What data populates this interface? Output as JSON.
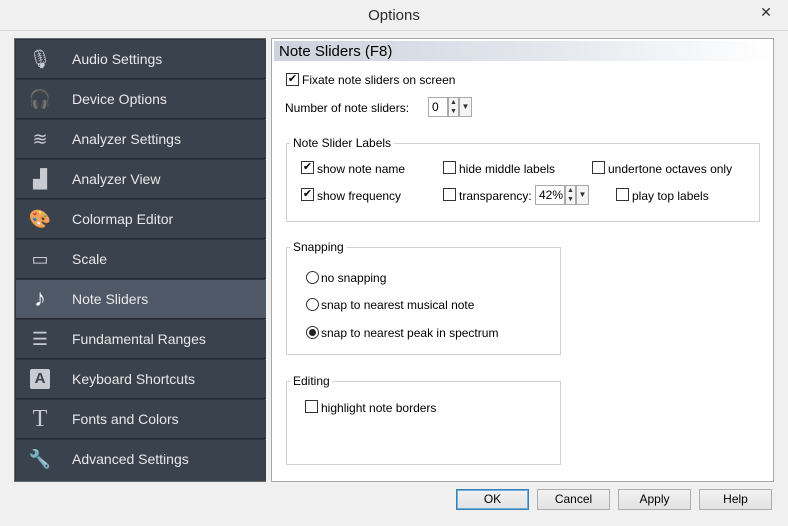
{
  "window": {
    "title": "Options",
    "close_label": "✕"
  },
  "sidebar": {
    "items": [
      {
        "label": "Audio Settings",
        "icon": "microphone-icon",
        "glyph": "🎙"
      },
      {
        "label": "Device Options",
        "icon": "headphones-icon",
        "glyph": "🎧"
      },
      {
        "label": "Analyzer Settings",
        "icon": "analyzer-settings-icon",
        "glyph": "≋"
      },
      {
        "label": "Analyzer View",
        "icon": "analyzer-view-icon",
        "glyph": "▟"
      },
      {
        "label": "Colormap Editor",
        "icon": "palette-icon",
        "glyph": "🎨"
      },
      {
        "label": "Scale",
        "icon": "ruler-icon",
        "glyph": "▭"
      },
      {
        "label": "Note Sliders",
        "icon": "music-note-icon",
        "glyph": "♪"
      },
      {
        "label": "Fundamental Ranges",
        "icon": "ranges-icon",
        "glyph": "☰"
      },
      {
        "label": "Keyboard Shortcuts",
        "icon": "keyboard-key-icon",
        "glyph": "A"
      },
      {
        "label": "Fonts and Colors",
        "icon": "font-icon",
        "glyph": "T"
      },
      {
        "label": "Advanced Settings",
        "icon": "wrench-icon",
        "glyph": "🔧"
      }
    ],
    "active_index": 6
  },
  "panel": {
    "title": "Note Sliders (F8)",
    "fixate_label": "Fixate note sliders on screen",
    "fixate_checked": true,
    "num_sliders_label": "Number of note sliders:",
    "num_sliders_value": "0",
    "labels_group": {
      "title": "Note Slider Labels",
      "show_note_name": "show note name",
      "hide_middle_labels": "hide middle labels",
      "undertone_octaves_only": "undertone octaves only",
      "show_frequency": "show frequency",
      "transparency": "transparency:",
      "transparency_value": "42%",
      "play_top_labels": "play top labels"
    },
    "snapping_group": {
      "title": "Snapping",
      "options": [
        "no snapping",
        "snap to nearest musical note",
        "snap to nearest peak in spectrum"
      ],
      "selected_index": 2
    },
    "editing_group": {
      "title": "Editing",
      "highlight_note_borders": "highlight note borders"
    }
  },
  "buttons": {
    "ok": "OK",
    "cancel": "Cancel",
    "apply": "Apply",
    "help": "Help"
  },
  "check_glyph": "✔",
  "spin_up": "▲",
  "spin_down": "▼"
}
